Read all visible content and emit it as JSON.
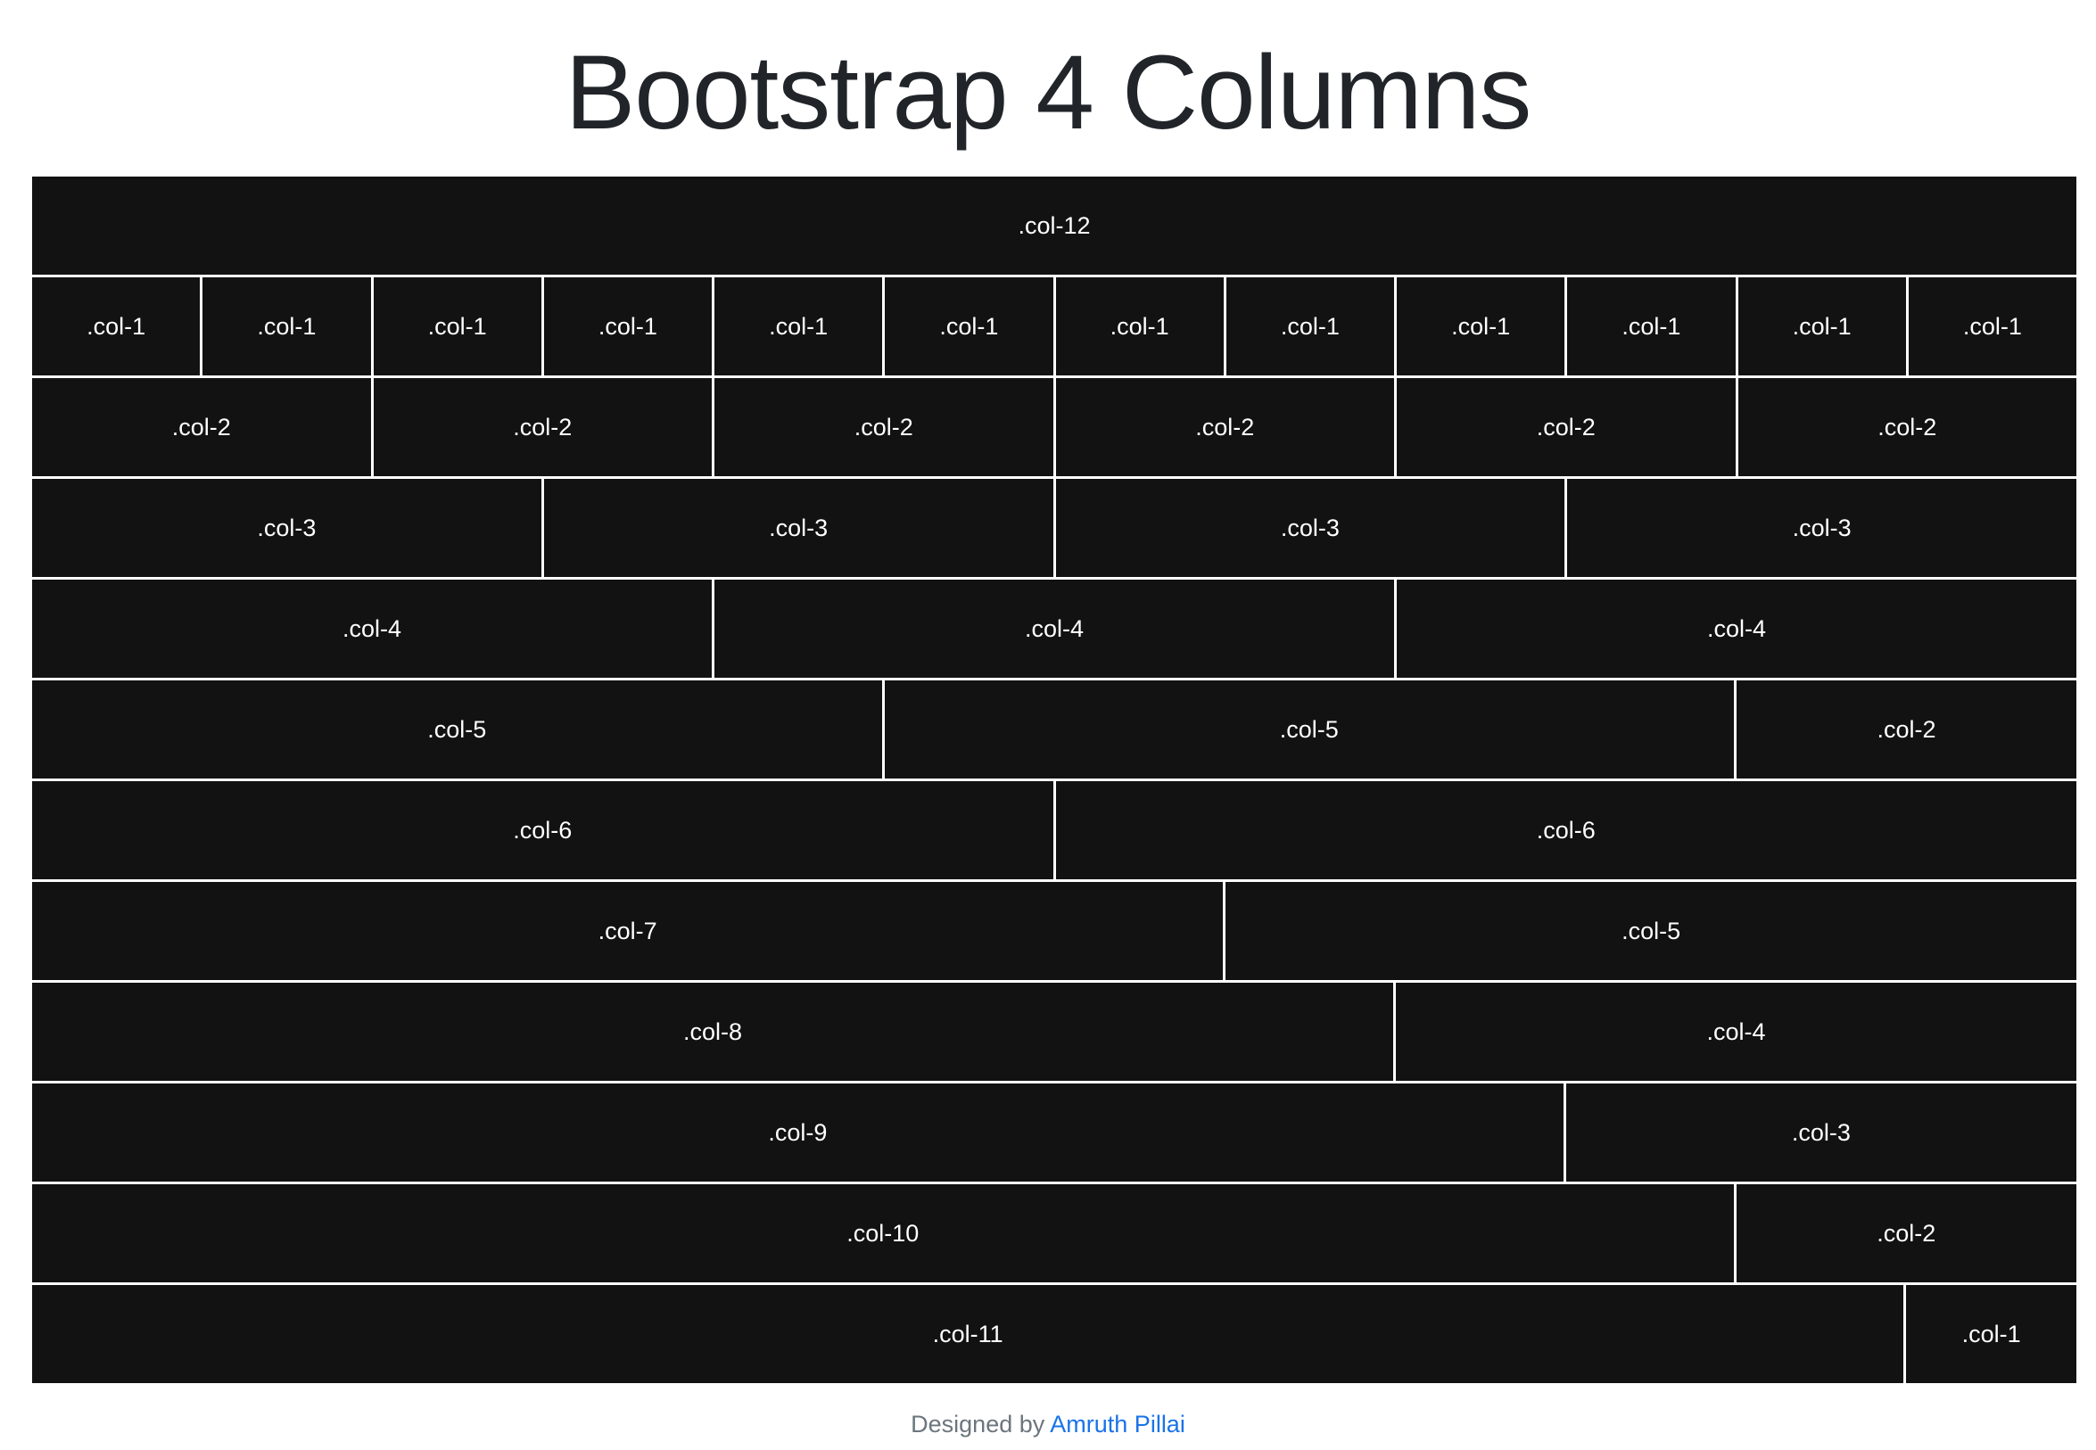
{
  "title": "Bootstrap 4 Columns",
  "rows": [
    [
      12
    ],
    [
      1,
      1,
      1,
      1,
      1,
      1,
      1,
      1,
      1,
      1,
      1,
      1
    ],
    [
      2,
      2,
      2,
      2,
      2,
      2
    ],
    [
      3,
      3,
      3,
      3
    ],
    [
      4,
      4,
      4
    ],
    [
      5,
      5,
      2
    ],
    [
      6,
      6
    ],
    [
      7,
      5
    ],
    [
      8,
      4
    ],
    [
      9,
      3
    ],
    [
      10,
      2
    ],
    [
      11,
      1
    ]
  ],
  "label_prefix": ".col-",
  "footer": {
    "text": "Designed by",
    "author": "Amruth Pillai"
  },
  "colors": {
    "cell_bg": "#121212",
    "cell_text": "#ffffff",
    "link": "#1a73e8"
  }
}
